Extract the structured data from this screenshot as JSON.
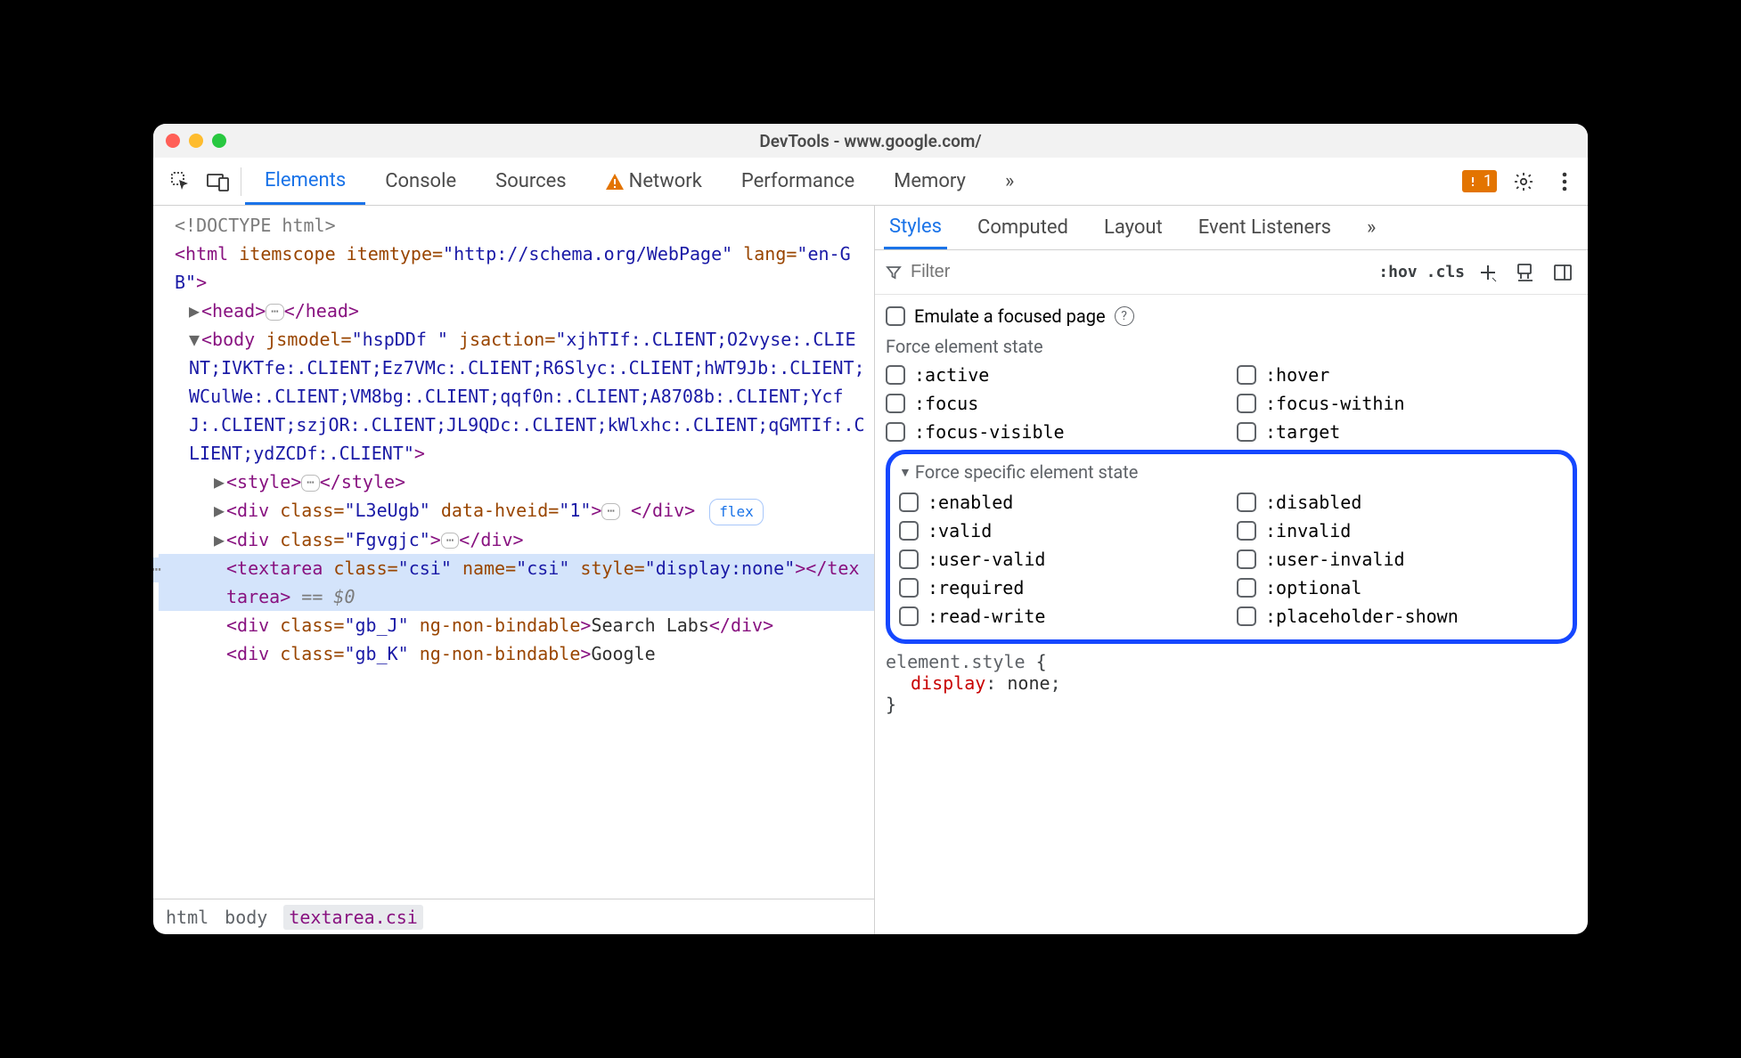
{
  "window": {
    "title": "DevTools - www.google.com/"
  },
  "mainTabs": {
    "items": [
      "Elements",
      "Console",
      "Sources",
      "Network",
      "Performance",
      "Memory"
    ],
    "active": "Elements",
    "warnOnNetwork": true,
    "moreLabel": "»"
  },
  "issues": {
    "count": "1"
  },
  "dom": {
    "doctype": "<!DOCTYPE html>",
    "htmlOpen": "<html itemscope itemtype=\"http://schema.org/WebPage\" lang=\"en-GB\">",
    "head": "<head>…</head>",
    "bodyOpenFull": "<body jsmodel=\"hspDDf \" jsaction=\"xjhTIf:.CLIENT;O2vyse:.CLIENT;IVKTfe:.CLIENT;Ez7VMc:.CLIENT;R6Slyc:.CLIENT;hWT9Jb:.CLIENT;WCulWe:.CLIENT;VM8bg:.CLIENT;qqf0n:.CLIENT;A8708b:.CLIENT;YcfJ:.CLIENT;szjOR:.CLIENT;JL9QDc:.CLIENT;kWlxhc:.CLIENT;qGMTIf:.CLIENT;ydZCDf:.CLIENT\">",
    "style": "<style>…</style>",
    "div1": "<div class=\"L3eUgb\" data-hveid=\"1\">…</div>",
    "flexBadge": "flex",
    "div2": "<div class=\"Fgvgjc\">…</div>",
    "textarea": "<textarea class=\"csi\" name=\"csi\" style=\"display:none\"></textarea>",
    "eq0": " == $0",
    "divGbJ_pre": "<div class=\"gb_J\" ng-non-bindable>",
    "divGbJ_text": "Search Labs",
    "divGbJ_post": "</div>",
    "divGbK_pre": "<div class=\"gb_K\" ng-non-bindable>",
    "divGbK_text": "Google"
  },
  "breadcrumb": {
    "items": [
      "html",
      "body",
      "textarea.csi"
    ],
    "active": "textarea.csi"
  },
  "rightTabs": {
    "items": [
      "Styles",
      "Computed",
      "Layout",
      "Event Listeners"
    ],
    "active": "Styles",
    "moreLabel": "»"
  },
  "filter": {
    "placeholder": "Filter",
    "hov": ":hov",
    "cls": ".cls"
  },
  "emulate": {
    "label": "Emulate a focused page"
  },
  "forceState": {
    "heading": "Force element state",
    "items": [
      ":active",
      ":hover",
      ":focus",
      ":focus-within",
      ":focus-visible",
      ":target"
    ]
  },
  "forceSpecific": {
    "heading": "Force specific element state",
    "items": [
      ":enabled",
      ":disabled",
      ":valid",
      ":invalid",
      ":user-valid",
      ":user-invalid",
      ":required",
      ":optional",
      ":read-write",
      ":placeholder-shown"
    ]
  },
  "stylesCode": {
    "selector": "element.style",
    "open": " {",
    "propName": "display",
    "propSep": ": ",
    "propVal": "none",
    "propEnd": ";",
    "close": "}"
  }
}
